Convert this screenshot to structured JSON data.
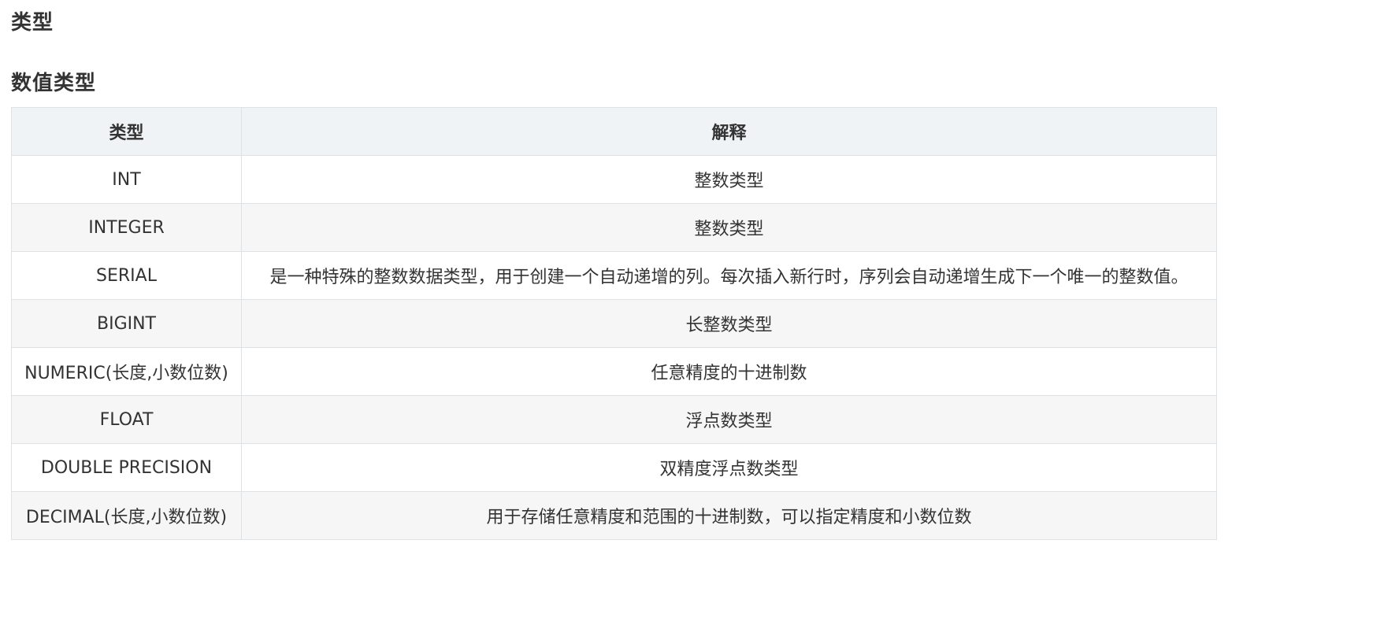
{
  "heading": "类型",
  "subheading": "数值类型",
  "table": {
    "headers": [
      "类型",
      "解释"
    ],
    "rows": [
      {
        "type": "INT",
        "desc": "整数类型"
      },
      {
        "type": "INTEGER",
        "desc": "整数类型"
      },
      {
        "type": "SERIAL",
        "desc": "是一种特殊的整数数据类型，用于创建一个自动递增的列。每次插入新行时，序列会自动递增生成下一个唯一的整数值。"
      },
      {
        "type": "BIGINT",
        "desc": "长整数类型"
      },
      {
        "type": "NUMERIC(长度,小数位数)",
        "desc": "任意精度的十进制数"
      },
      {
        "type": "FLOAT",
        "desc": "浮点数类型"
      },
      {
        "type": "DOUBLE PRECISION",
        "desc": "双精度浮点数类型"
      },
      {
        "type": "DECIMAL(长度,小数位数)",
        "desc": "用于存储任意精度和范围的十进制数，可以指定精度和小数位数"
      }
    ]
  }
}
